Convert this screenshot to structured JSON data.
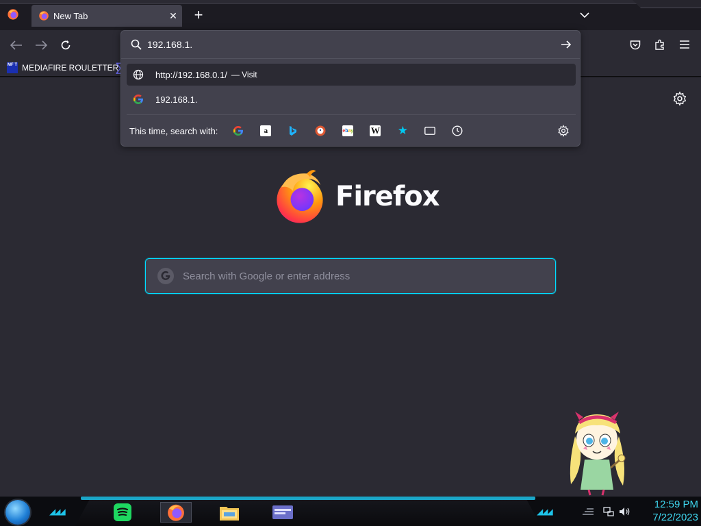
{
  "tab": {
    "title": "New Tab"
  },
  "bookmarks": {
    "items": [
      {
        "label": "MEDIAFIRE ROULETTER",
        "icon": "mft-favicon",
        "icon_text": "MF T"
      }
    ]
  },
  "urlbar": {
    "value": "192.168.1.",
    "results": [
      {
        "icon": "globe-icon",
        "url": "http://192.168.0.1/",
        "action": "— Visit"
      },
      {
        "icon": "google-icon",
        "url": "192.168.1.",
        "action": ""
      }
    ],
    "oneoff_label": "This time, search with:",
    "oneoff_engines": [
      {
        "name": "google-engine-icon",
        "glyph": "G",
        "color": "#4285f4"
      },
      {
        "name": "amazon-engine-icon",
        "glyph": "a",
        "color": "#ff9900"
      },
      {
        "name": "bing-engine-icon",
        "glyph": "b",
        "color": "#1a73e8"
      },
      {
        "name": "duckduckgo-engine-icon",
        "glyph": "D",
        "color": "#de5833"
      },
      {
        "name": "ebay-engine-icon",
        "glyph": "ebay",
        "color": "#e53238"
      },
      {
        "name": "wikipedia-engine-icon",
        "glyph": "W",
        "color": "#000000"
      },
      {
        "name": "bookmarks-icon",
        "glyph": "★",
        "color": "#00c8f0"
      },
      {
        "name": "tabs-icon",
        "glyph": "",
        "color": "#fbfbfe"
      },
      {
        "name": "history-icon",
        "glyph": "",
        "color": "#fbfbfe"
      }
    ]
  },
  "newtab": {
    "brand": "Firefox",
    "search_placeholder": "Search with Google or enter address"
  },
  "taskbar": {
    "time": "12:59 PM",
    "date": "7/22/2023",
    "apps": [
      "spotify-icon",
      "firefox-icon",
      "file-explorer-icon",
      "app-window-icon"
    ]
  },
  "colors": {
    "accent": "#00ddff",
    "clock": "#3fd7f0",
    "bg": "#2b2a33"
  }
}
